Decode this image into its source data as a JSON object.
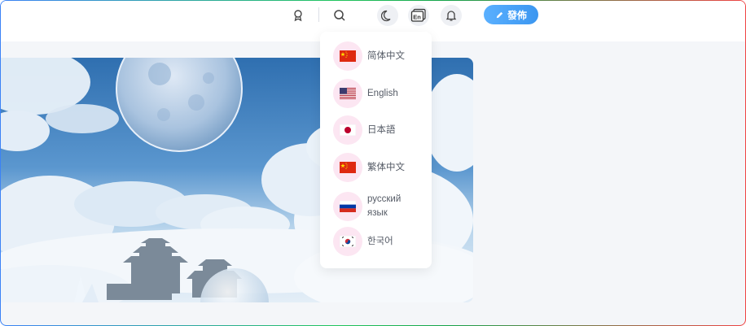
{
  "header": {
    "publish_label": "發佈",
    "icons": [
      "badge-icon",
      "search-icon",
      "moon-icon",
      "language-icon",
      "bell-icon",
      "pencil-icon"
    ]
  },
  "language_menu": {
    "items": [
      {
        "label": "简体中文",
        "flag": "china-flag"
      },
      {
        "label": "English",
        "flag": "usa-flag"
      },
      {
        "label": "日本語",
        "flag": "japan-flag"
      },
      {
        "label": "繁体中文",
        "flag": "china-flag"
      },
      {
        "label": "русский язык",
        "flag": "russia-flag"
      },
      {
        "label": "한국어",
        "flag": "korea-flag"
      }
    ]
  },
  "colors": {
    "accent": "#3b96f0",
    "flag_circle": "#fce6f2",
    "page_bg": "#f4f6f9"
  }
}
